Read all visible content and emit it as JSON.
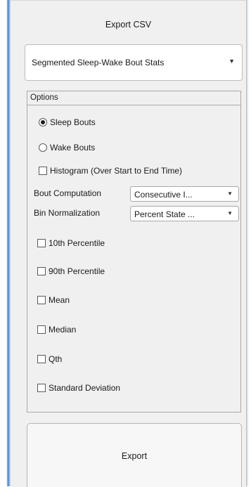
{
  "header": {
    "title": "Export CSV"
  },
  "export_type": {
    "selected": "Segmented Sleep-Wake Bout Stats"
  },
  "options": {
    "group_title": "Options",
    "radios": [
      {
        "label": "Sleep Bouts",
        "selected": true
      },
      {
        "label": "Wake Bouts",
        "selected": false
      }
    ],
    "histogram": {
      "label": "Histogram (Over Start to End Time)",
      "checked": false
    },
    "bout_computation": {
      "label": "Bout Computation",
      "value": "Consecutive I..."
    },
    "bin_normalization": {
      "label": "Bin Normalization",
      "value": "Percent State ..."
    },
    "stats": [
      {
        "label": "10th Percentile",
        "checked": false
      },
      {
        "label": "90th Percentile",
        "checked": false
      },
      {
        "label": "Mean",
        "checked": false
      },
      {
        "label": "Median",
        "checked": false
      },
      {
        "label": "Qth",
        "checked": false
      },
      {
        "label": "Standard Deviation",
        "checked": false
      }
    ]
  },
  "actions": {
    "export_label": "Export"
  },
  "icons": {
    "dropdown": "chevron-down-icon"
  }
}
